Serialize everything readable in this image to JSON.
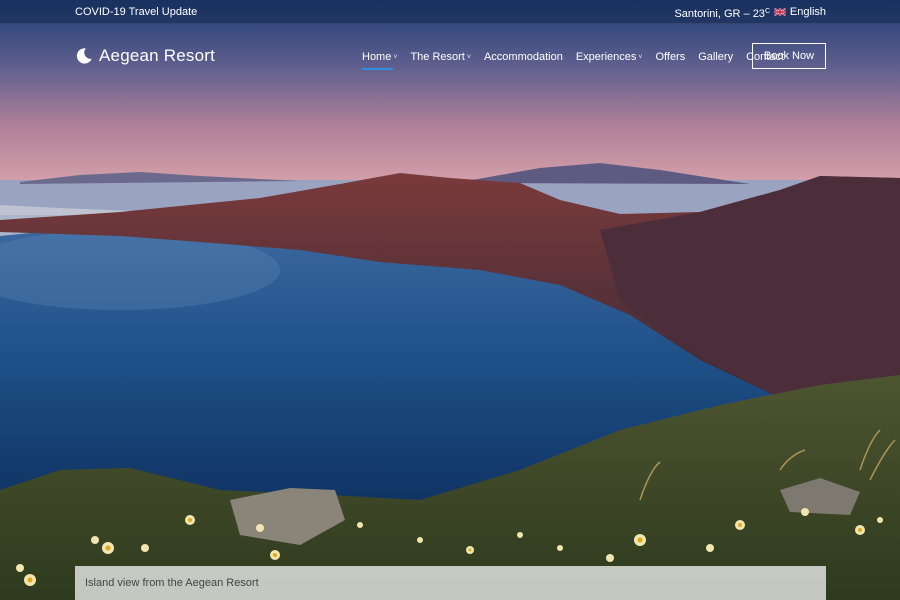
{
  "topbar": {
    "covid_link": "COVID-19 Travel Update",
    "location": "Santorini, GR – 23",
    "degree": "C",
    "language": "English",
    "flag_icon": "uk-flag-icon"
  },
  "brand": {
    "name": "Aegean Resort",
    "icon": "crescent-moon-icon"
  },
  "nav": {
    "items": [
      {
        "label": "Home",
        "has_dropdown": true,
        "active": true
      },
      {
        "label": "The Resort",
        "has_dropdown": true
      },
      {
        "label": "Accommodation",
        "has_dropdown": false
      },
      {
        "label": "Experiences",
        "has_dropdown": true
      },
      {
        "label": "Offers",
        "has_dropdown": false
      },
      {
        "label": "Gallery",
        "has_dropdown": false
      },
      {
        "label": "Contact",
        "has_dropdown": false
      }
    ],
    "book_label": "Book Now",
    "caret_glyph": "˅"
  },
  "hero": {
    "caption": "Island view from the Aegean Resort"
  },
  "colors": {
    "active_underline": "#2f8ee0",
    "sea": "#1d4f86",
    "sky_top": "#24427a",
    "sky_bottom": "#d49da8"
  }
}
